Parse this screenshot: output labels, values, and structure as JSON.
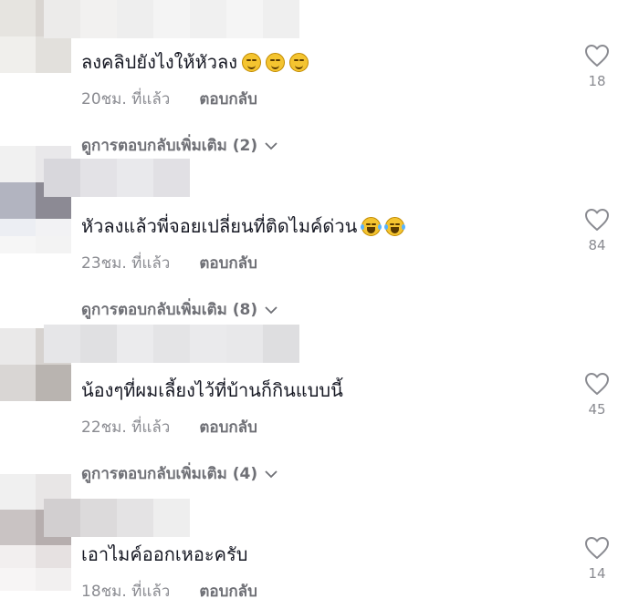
{
  "comments": [
    {
      "text": "ลงคลิปยังไงให้หัวลง",
      "time": "20ชม. ที่แล้ว",
      "reply_label": "ตอบกลับ",
      "likes": "18",
      "view_replies": "ดูการตอบกลับเพิ่มเติม (2)",
      "emoji": [
        "smirk-emoji",
        "smirk-emoji",
        "smirk-emoji"
      ]
    },
    {
      "text": "หัวลงแล้วพี่จอยเปลี่ยนที่ติดไมค์ด่วน",
      "time": "23ชม. ที่แล้ว",
      "reply_label": "ตอบกลับ",
      "likes": "84",
      "view_replies": "ดูการตอบกลับเพิ่มเติม (8)",
      "emoji": [
        "tears-of-joy-emoji",
        "tears-of-joy-emoji"
      ]
    },
    {
      "text": "น้องๆที่ผมเลี้ยงไว้ที่บ้านก็กินแบบนี้",
      "time": "22ชม. ที่แล้ว",
      "reply_label": "ตอบกลับ",
      "likes": "45",
      "view_replies": "ดูการตอบกลับเพิ่มเติม (4)",
      "emoji": []
    },
    {
      "text": "เอาไมค์ออกเหอะครับ",
      "time": "18ชม. ที่แล้ว",
      "reply_label": "ตอบกลับ",
      "likes": "14",
      "emoji": []
    }
  ],
  "colors": {
    "text": "#161823",
    "muted": "#8a8b91",
    "like_icon": "#8a8b91"
  }
}
